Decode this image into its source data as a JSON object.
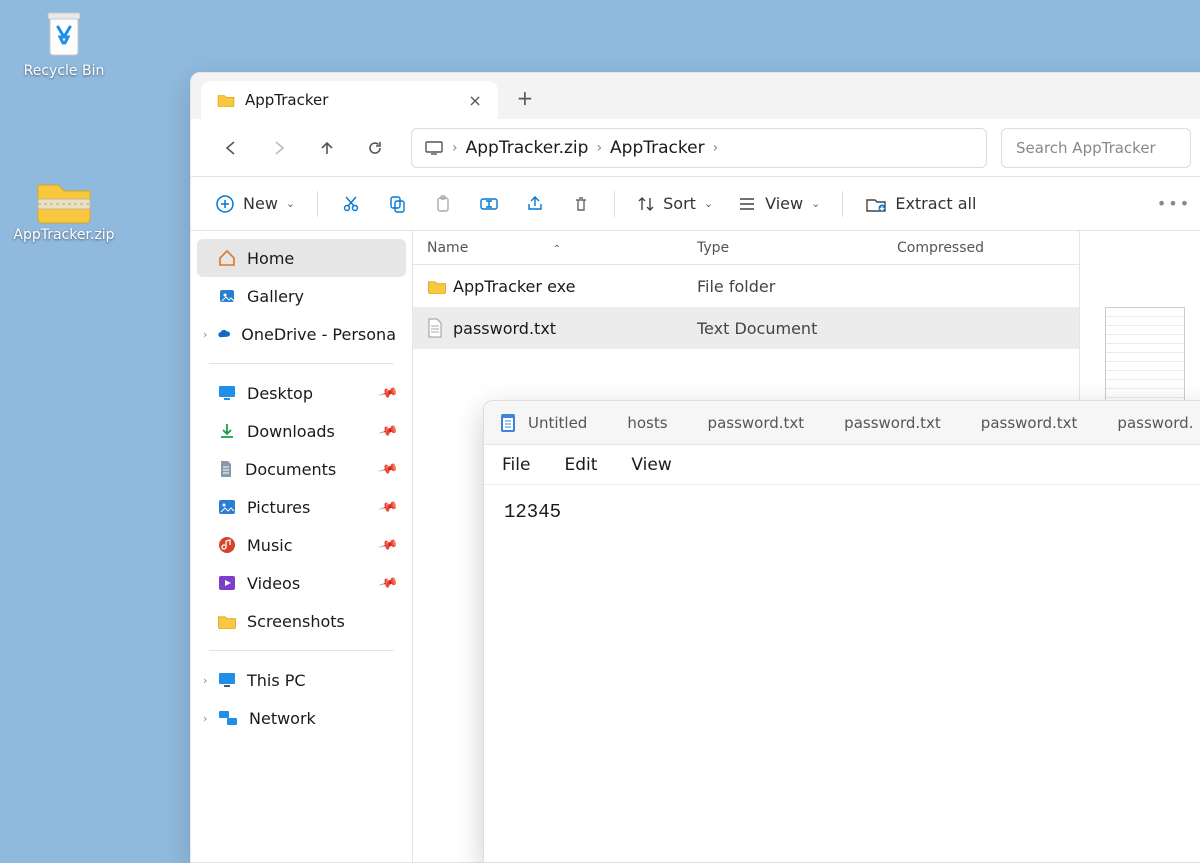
{
  "desktop": {
    "recycle_bin": "Recycle Bin",
    "zip_file": "AppTracker.zip"
  },
  "explorer": {
    "tab_title": "AppTracker",
    "breadcrumb": {
      "seg1": "AppTracker.zip",
      "seg2": "AppTracker"
    },
    "search_placeholder": "Search AppTracker",
    "toolbar": {
      "new": "New",
      "sort": "Sort",
      "view": "View",
      "extract": "Extract all"
    },
    "columns": {
      "name": "Name",
      "type": "Type",
      "compressed": "Compressed"
    },
    "rows": [
      {
        "name": "AppTracker exe",
        "type": "File folder",
        "kind": "folder"
      },
      {
        "name": "password.txt",
        "type": "Text Document",
        "kind": "text"
      }
    ],
    "sidebar": {
      "home": "Home",
      "gallery": "Gallery",
      "onedrive": "OneDrive - Persona",
      "desktop": "Desktop",
      "downloads": "Downloads",
      "documents": "Documents",
      "pictures": "Pictures",
      "music": "Music",
      "videos": "Videos",
      "screenshots": "Screenshots",
      "thispc": "This PC",
      "network": "Network"
    }
  },
  "notepad": {
    "tabs": [
      "Untitled",
      "hosts",
      "password.txt",
      "password.txt",
      "password.txt",
      "password."
    ],
    "menu": {
      "file": "File",
      "edit": "Edit",
      "view": "View"
    },
    "content": "12345"
  }
}
